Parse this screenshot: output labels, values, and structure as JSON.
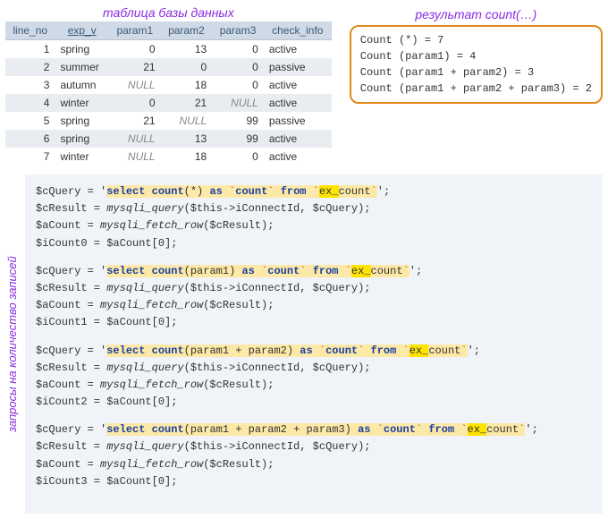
{
  "table": {
    "title": "таблица базы данных",
    "columns": [
      "line_no",
      "exp_v",
      "param1",
      "param2",
      "param3",
      "check_info"
    ],
    "rows": [
      {
        "line_no": "1",
        "exp_v": "spring",
        "param1": "0",
        "param2": "13",
        "param3": "0",
        "check_info": "active"
      },
      {
        "line_no": "2",
        "exp_v": "summer",
        "param1": "21",
        "param2": "0",
        "param3": "0",
        "check_info": "passive"
      },
      {
        "line_no": "3",
        "exp_v": "autumn",
        "param1": "NULL",
        "param2": "18",
        "param3": "0",
        "check_info": "active"
      },
      {
        "line_no": "4",
        "exp_v": "winter",
        "param1": "0",
        "param2": "21",
        "param3": "NULL",
        "check_info": "active"
      },
      {
        "line_no": "5",
        "exp_v": "spring",
        "param1": "21",
        "param2": "NULL",
        "param3": "99",
        "check_info": "passive"
      },
      {
        "line_no": "6",
        "exp_v": "spring",
        "param1": "NULL",
        "param2": "13",
        "param3": "99",
        "check_info": "active"
      },
      {
        "line_no": "7",
        "exp_v": "winter",
        "param1": "NULL",
        "param2": "18",
        "param3": "0",
        "check_info": "active"
      }
    ]
  },
  "results": {
    "title": "результат count(…)",
    "lines": [
      "Count (*) = 7",
      "Count (param1) = 4",
      "Count (param1 + param2) = 3",
      "Count (param1 + param2 + param3) = 2"
    ]
  },
  "vert_label": "запросы на количество записей",
  "code": {
    "blocks": [
      {
        "query_prefix": "$cQuery  = '",
        "sql_select": "select",
        "sql_count": "count",
        "sql_args": "(*)",
        "sql_as": "as",
        "sql_alias_q1": "`",
        "sql_alias": "count",
        "sql_alias_q2": "`",
        "sql_from": "from",
        "sql_t_q1": "`",
        "sql_t_ex": "ex_",
        "sql_t_name": "count",
        "sql_t_q2": "`",
        "query_suffix": "';",
        "line2": "$cResult = mysqli_query($this->iConnectId, $cQuery);",
        "line3": "$aCount  = mysqli_fetch_row($cResult);",
        "line4": "$iCount0 = $aCount[0];"
      },
      {
        "query_prefix": "$cQuery  = '",
        "sql_select": "select",
        "sql_count": "count",
        "sql_args": "(param1)",
        "sql_as": "as",
        "sql_alias_q1": "`",
        "sql_alias": "count",
        "sql_alias_q2": "`",
        "sql_from": "from",
        "sql_t_q1": "`",
        "sql_t_ex": "ex_",
        "sql_t_name": "count",
        "sql_t_q2": "`",
        "query_suffix": "';",
        "line2": "$cResult = mysqli_query($this->iConnectId, $cQuery);",
        "line3": "$aCount  = mysqli_fetch_row($cResult);",
        "line4": "$iCount1 = $aCount[0];"
      },
      {
        "query_prefix": "$cQuery  = '",
        "sql_select": "select",
        "sql_count": "count",
        "sql_args": "(param1 + param2)",
        "sql_as": "as",
        "sql_alias_q1": "`",
        "sql_alias": "count",
        "sql_alias_q2": "`",
        "sql_from": "from",
        "sql_t_q1": "`",
        "sql_t_ex": "ex_",
        "sql_t_name": "count",
        "sql_t_q2": "`",
        "query_suffix": "';",
        "line2": "$cResult = mysqli_query($this->iConnectId, $cQuery);",
        "line3": "$aCount  = mysqli_fetch_row($cResult);",
        "line4": "$iCount2 = $aCount[0];"
      },
      {
        "query_prefix": "$cQuery  = '",
        "sql_select": "select",
        "sql_count": "count",
        "sql_args": "(param1 + param2 + param3)",
        "sql_as": "as",
        "sql_alias_q1": "`",
        "sql_alias": "count",
        "sql_alias_q2": "`",
        "sql_from": "from",
        "sql_t_q1": "`",
        "sql_t_ex": "ex_",
        "sql_t_name": "count",
        "sql_t_q2": "`",
        "query_suffix": "';",
        "line2": "$cResult = mysqli_query($this->iConnectId, $cQuery);",
        "line3": "$aCount  = mysqli_fetch_row($cResult);",
        "line4": "$iCount3 = $aCount[0];"
      }
    ]
  }
}
